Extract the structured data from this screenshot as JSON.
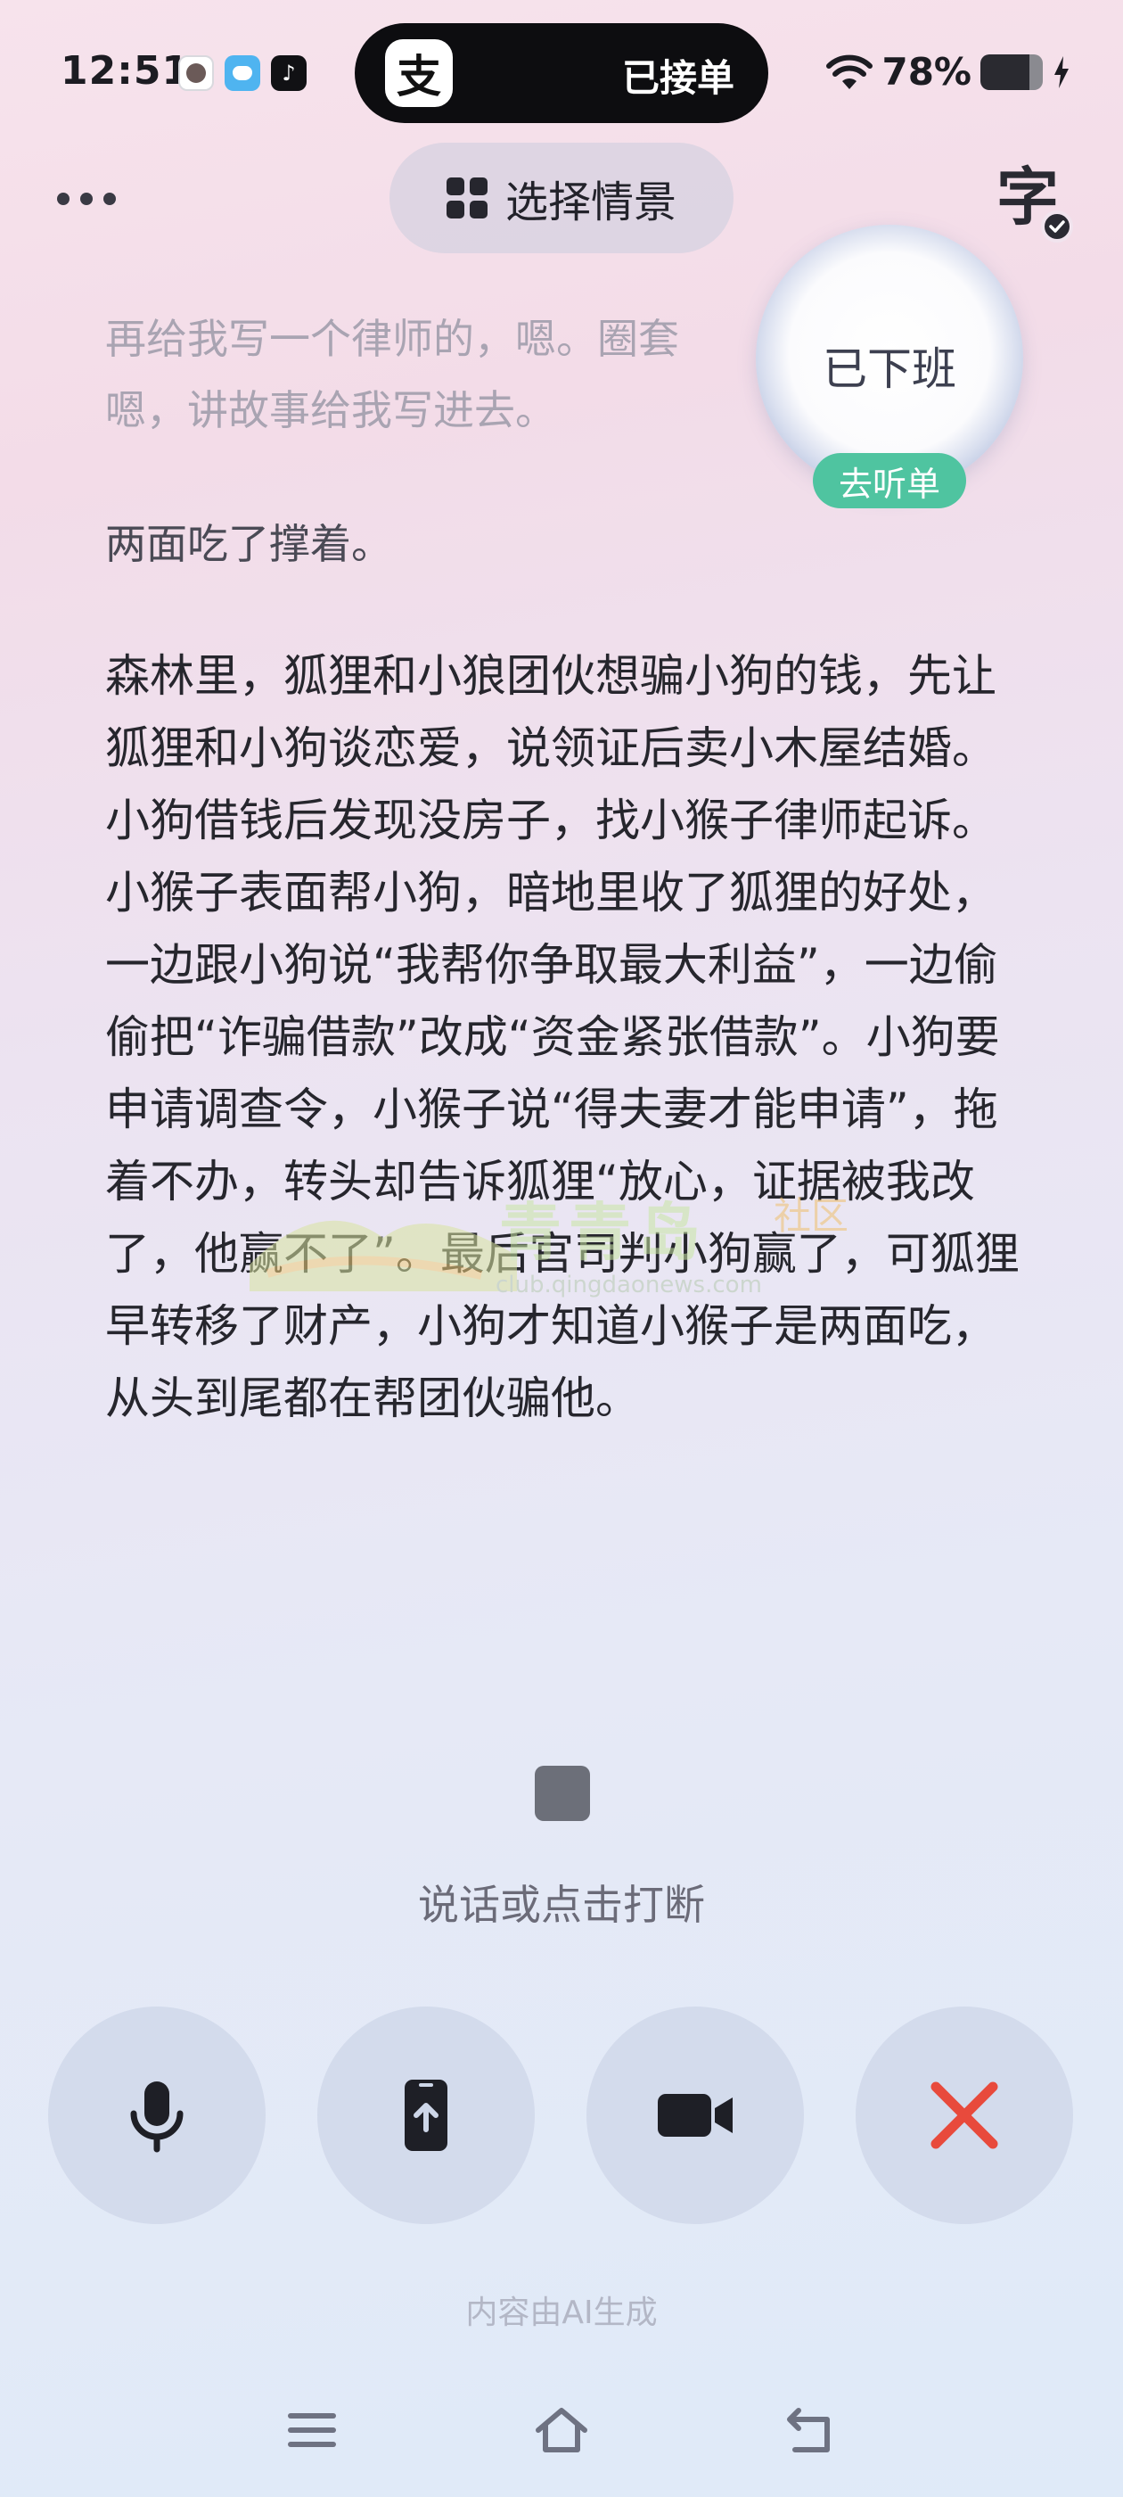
{
  "status_bar": {
    "time": "12:51",
    "alipay_glyph": "支",
    "island_text": "已接单",
    "battery_percent_label": "78%",
    "battery_level": 0.78,
    "notification_icons": [
      "avatar-icon",
      "bird-app-icon",
      "tiktok-icon"
    ],
    "tiktok_glyph": "♪"
  },
  "top_bar": {
    "scene_label": "选择情景",
    "subtitle_char": "字"
  },
  "widget": {
    "label": "已下班",
    "pill": "去听单",
    "pill_color": "#4fc4a0"
  },
  "transcript": {
    "faded_text": "再给我写一个律师的，嗯。圈套嗯，讲故事给我写进去。",
    "short_para": "两面吃了撑着。",
    "story": "森林里，狐狸和小狼团伙想骗小狗的钱，先让狐狸和小狗谈恋爱，说领证后卖小木屋结婚。小狗借钱后发现没房子，找小猴子律师起诉。小猴子表面帮小狗，暗地里收了狐狸的好处，一边跟小狗说“我帮你争取最大利益”，一边偷偷把“诈骗借款”改成“资金紧张借款”。小狗要申请调查令，小猴子说“得夫妻才能申请”，拖着不办，转头却告诉狐狸“放心，证据被我改了，他赢不了”。最后官司判小狗赢了，可狐狸早转移了财产，小狗才知道小猴子是两面吃，从头到尾都在帮团伙骗他。"
  },
  "watermark": {
    "title": "青青岛",
    "sub": "社区",
    "url": "club.qingdaonews.com"
  },
  "interrupt_hint": "说话或点击打断",
  "controls": {
    "icons": [
      "microphone-icon",
      "share-screen-icon",
      "video-camera-icon",
      "close-icon"
    ],
    "close_color": "#e84a3c"
  },
  "ai_note": "内容由AI生成"
}
